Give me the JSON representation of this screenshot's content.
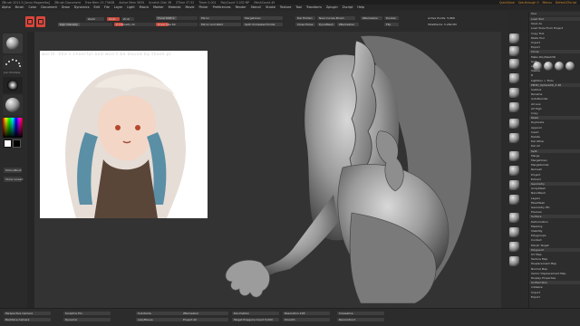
{
  "titlebar": {
    "items": [
      "ZBrush 2021.5 [Anna Magarelba]",
      "ZBrush Document",
      "Free Mem 25.736GB",
      "Active Mem 5639",
      "Scratch Disk 36",
      "ZTime 37.52",
      "Timer 0.001",
      "PolyCount 3.032 MP",
      "MeshCount 49"
    ],
    "right": [
      "QuickSave",
      "See-through 0",
      "Menus",
      "DefaultZScript"
    ]
  },
  "menubar": {
    "items": [
      "Alpha",
      "Brush",
      "Color",
      "Document",
      "Draw",
      "Dynamics",
      "Edit",
      "File",
      "Layer",
      "Light",
      "Macro",
      "Marker",
      "Material",
      "Movie",
      "Picker",
      "Preferences",
      "Render",
      "Stencil",
      "Stroke",
      "Texture",
      "Tool",
      "Transform",
      "Zplugin",
      "Zscript",
      "Help"
    ]
  },
  "subtitle": "ROTATEAIRAUT",
  "toolbar": {
    "zadd": "Zadd",
    "zsub": "Zsub",
    "zcut": "Zcut",
    "rgb_intensity": "Rgb Intensity",
    "z_intensity": "Z Intensity 22",
    "focal_shift": "Focal Shift 0",
    "draw_size": "Draw Size 64",
    "mirror": "Mirror",
    "mirror_weld": "Mirror And Weld",
    "merge_down": "MergeDown",
    "split_unmasked": "Split Unmasked Points",
    "del_hidden": "Del Hidden",
    "close_holes": "Close Holes",
    "new_curves": "New Curves Brush",
    "dynamesh": "DynaMesh",
    "zremesher": "ZRemesher",
    "double": "Double",
    "flip": "Flip",
    "active_points": "Active Points: 5,869",
    "total_points": "TotalPoints: 5.269 Mil"
  },
  "leftpanel": {
    "label1": "Join Multiple",
    "label2": "PictureBook",
    "label3": "Show Lineart"
  },
  "reference": {
    "caption": "world. She's cheerful and won't be bound by those pr"
  },
  "rightshelf": {
    "buttons": [
      "Frame",
      "Move",
      "Scale",
      "Rotate",
      "PolyF",
      "Transp",
      "Solo",
      "Xpose"
    ]
  },
  "rightpanel": {
    "tool_title": "Tool",
    "rows": [
      "Load Tool",
      "Save As",
      "Load Tools From Project",
      "Copy Tool",
      "Paste Tool",
      "Import",
      "Export",
      "Clone",
      "Make PolyMesh3D",
      "GoZ",
      "All",
      "Visible",
      "R",
      "Lightbox > Tools",
      "PM3D_Sphere3D_3 48",
      "Subtool",
      "Rename",
      "AutoReorder",
      "All Low",
      "All High",
      "Copy",
      "Paste",
      "Duplicate",
      "Append",
      "Insert",
      "Delete",
      "Del Other",
      "Del All",
      "Split",
      "Merge",
      "MergeDown",
      "MergeSimilar",
      "Remesh",
      "Project",
      "Extract",
      "Geometry",
      "ArrayMesh",
      "NanoMesh",
      "Layers",
      "FiberMesh",
      "Geometry HD",
      "Preview",
      "Surface",
      "Deformation",
      "Masking",
      "Visibility",
      "Polygroups",
      "Contact",
      "Morph Target",
      "Polypaint",
      "UV Map",
      "Texture Map",
      "Displacement Map",
      "Normal Map",
      "Vector Displacement Map",
      "Display Properties",
      "Unified Skin",
      "Initialize",
      "Import",
      "Export"
    ]
  },
  "bottombar": {
    "items": [
      "Perspective Camera",
      "Backface Camera",
      "Sculptris Pro",
      "Dynamic",
      "Subdivide",
      "LazyMouse",
      "ZRemesher",
      "Project All",
      "Decimation",
      "Target Polygons Count 5,000",
      "Resolution 128",
      "Smooth",
      "Creaseline",
      "Reconstruct"
    ]
  },
  "colors": {
    "accent": "#d9463b",
    "panel": "#2d2d2d",
    "viewport": "#333333"
  }
}
